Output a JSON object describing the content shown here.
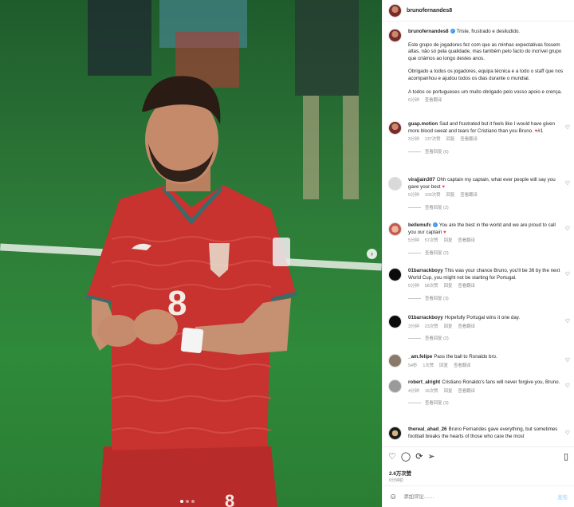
{
  "photo": {
    "description_alt": ""
  },
  "post": {
    "username": "brunofernandes8",
    "caption_title": "Triste, frustrado e desiludido.",
    "caption_paragraphs": [
      "Este grupo de jogadores fez com que as minhas expectativas fossem altas, não só pela qualidade, mas também pelo facto do incrível grupo que criámos ao longo destes anos.",
      "Obrigado a todos os jogadores, equipa técnica e a todo o staff que nos acompanhou e ajudou todos os dias durante o mundial.",
      "A todos os portugueses um muito obrigado pelo vosso apoio e crença."
    ],
    "caption_time": "6分钟",
    "caption_translate": "查看翻译",
    "likes": "2.6万次赞",
    "posted_ago": "6分钟前",
    "add_comment_placeholder": "添加评论……",
    "post_button": "发布"
  },
  "comments": [
    {
      "user": "guap.motion",
      "text": "Sad and frustrated but it feels like I would have given more blood sweat and tears for Cristiano than you Bruno. ",
      "tail": "#1",
      "time": "3分钟",
      "likes": "137次赞",
      "reply": "回复",
      "translate": "查看翻译",
      "replies": "查看回复 (6)"
    },
    {
      "user": "virajjain307",
      "text": "Ohh captain my captain, what ever people will say you gave your best ",
      "time": "5分钟",
      "likes": "105次赞",
      "reply": "回复",
      "translate": "查看翻译",
      "replies": "查看回复 (2)"
    },
    {
      "user": "bellemufc",
      "text": "You are the best in the world and we are proud to call you our captain ",
      "time": "5分钟",
      "likes": "57次赞",
      "reply": "回复",
      "translate": "查看翻译",
      "replies": "查看回复 (2)"
    },
    {
      "user": "01barrackboyy",
      "text": "This was your chance Bruno, you'll be 36 by the next World Cup, you might not be starting for Portugal.",
      "time": "5分钟",
      "likes": "58次赞",
      "reply": "回复",
      "translate": "查看翻译",
      "replies": "查看回复 (3)"
    },
    {
      "user": "01barrackboyy",
      "text": "Hopefully Portugal wins it one day.",
      "time": "3分钟",
      "likes": "23次赞",
      "reply": "回复",
      "translate": "查看翻译",
      "replies": "查看回复 (2)"
    },
    {
      "user": "_am.felipe",
      "text": "Pass the ball to Ronaldo bro.",
      "time": "54秒",
      "likes": "1次赞",
      "reply": "回复",
      "translate": "查看翻译"
    },
    {
      "user": "robert_alright",
      "text": "Cristiano Ronaldo's fans will never forgive you, Bruno.",
      "time": "4分钟",
      "likes": "16次赞",
      "reply": "回复",
      "translate": "查看翻译",
      "replies": "查看回复 (3)"
    },
    {
      "user": "thereal_ahad_26",
      "text": "Bruno Fernandes gave everything, but sometimes football breaks the hearts of those who care the most"
    }
  ],
  "icons": {
    "heart": "heart-icon",
    "comment": "comment-icon",
    "share": "share-icon",
    "save": "bookmark-icon",
    "emoji": "emoji-icon",
    "next": "chevron-right-icon"
  },
  "colors": {
    "link": "#3897f0",
    "heart_red": "#ed4956",
    "jersey": "#c8322f"
  }
}
